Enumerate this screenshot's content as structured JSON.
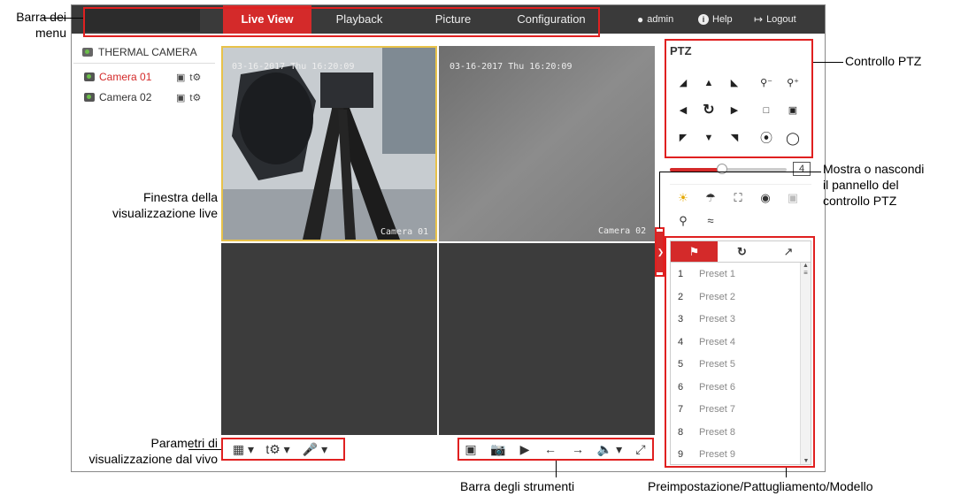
{
  "nav": {
    "tabs": [
      "Live View",
      "Playback",
      "Picture",
      "Configuration"
    ],
    "active_tab": "Live View",
    "user": "admin",
    "help": "Help",
    "logout": "Logout"
  },
  "device_tree": {
    "root": "THERMAL CAMERA",
    "cameras": [
      {
        "label": "Camera 01",
        "color": "#d42a2a"
      },
      {
        "label": "Camera 02",
        "color": "#333333"
      }
    ]
  },
  "video": {
    "osd_time_1": "03-16-2017 Thu 16:20:09",
    "osd_time_2": "03-16-2017 Thu 16:20:09",
    "cam_label_1": "Camera 01",
    "cam_label_2": "Camera 02"
  },
  "ptz": {
    "title": "PTZ",
    "speed": "4",
    "speed_fraction": 0.45,
    "presets": [
      {
        "num": "1",
        "name": "Preset 1"
      },
      {
        "num": "2",
        "name": "Preset 2"
      },
      {
        "num": "3",
        "name": "Preset 3"
      },
      {
        "num": "4",
        "name": "Preset 4"
      },
      {
        "num": "5",
        "name": "Preset 5"
      },
      {
        "num": "6",
        "name": "Preset 6"
      },
      {
        "num": "7",
        "name": "Preset 7"
      },
      {
        "num": "8",
        "name": "Preset 8"
      },
      {
        "num": "9",
        "name": "Preset 9"
      }
    ]
  },
  "annotations": {
    "menu_bar_1": "Barra dei",
    "menu_bar_2": "menu",
    "ptz_control": "Controllo PTZ",
    "live_window_1": "Finestra della",
    "live_window_2": "visualizzazione live",
    "hide_panel_1": "Mostra o nascondi",
    "hide_panel_2": "il pannello del",
    "hide_panel_3": "controllo PTZ",
    "live_params_1": "Parametri di",
    "live_params_2": "visualizzazione dal vivo",
    "toolbar": "Barra degli strumenti",
    "preset_patrol": "Preimpostazione/Pattugliamento/Modello"
  },
  "colors": {
    "accent": "#d42a2a",
    "topbar": "#3a3a3a",
    "callout": "#e02020"
  }
}
